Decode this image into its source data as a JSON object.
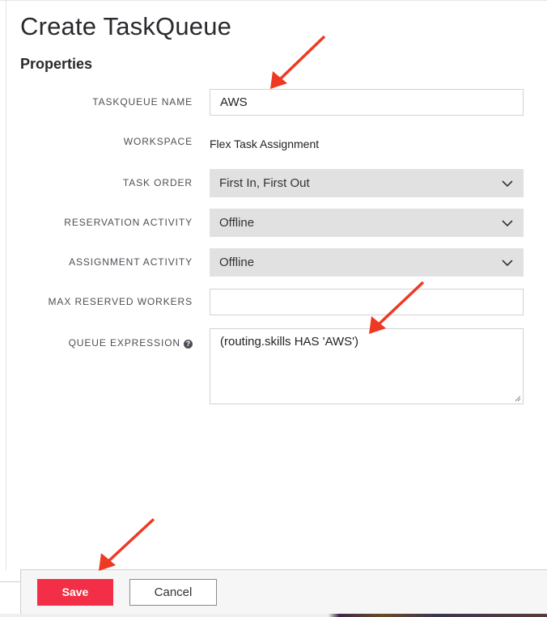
{
  "page": {
    "title": "Create TaskQueue",
    "section_title": "Properties"
  },
  "form": {
    "taskqueue_name": {
      "label": "TASKQUEUE NAME",
      "value": "AWS"
    },
    "workspace": {
      "label": "WORKSPACE",
      "value": "Flex Task Assignment"
    },
    "task_order": {
      "label": "TASK ORDER",
      "value": "First In, First Out"
    },
    "reservation_activity": {
      "label": "RESERVATION ACTIVITY",
      "value": "Offline"
    },
    "assignment_activity": {
      "label": "ASSIGNMENT ACTIVITY",
      "value": "Offline"
    },
    "max_reserved_workers": {
      "label": "MAX RESERVED WORKERS",
      "value": ""
    },
    "queue_expression": {
      "label": "QUEUE EXPRESSION",
      "value": "(routing.skills HAS 'AWS')",
      "help_icon": "question-circle-icon"
    }
  },
  "footer": {
    "save_label": "Save",
    "cancel_label": "Cancel"
  },
  "colors": {
    "accent": "#f22f46",
    "annotation_arrow": "#ee3a24",
    "select_bg": "#e1e1e1"
  }
}
